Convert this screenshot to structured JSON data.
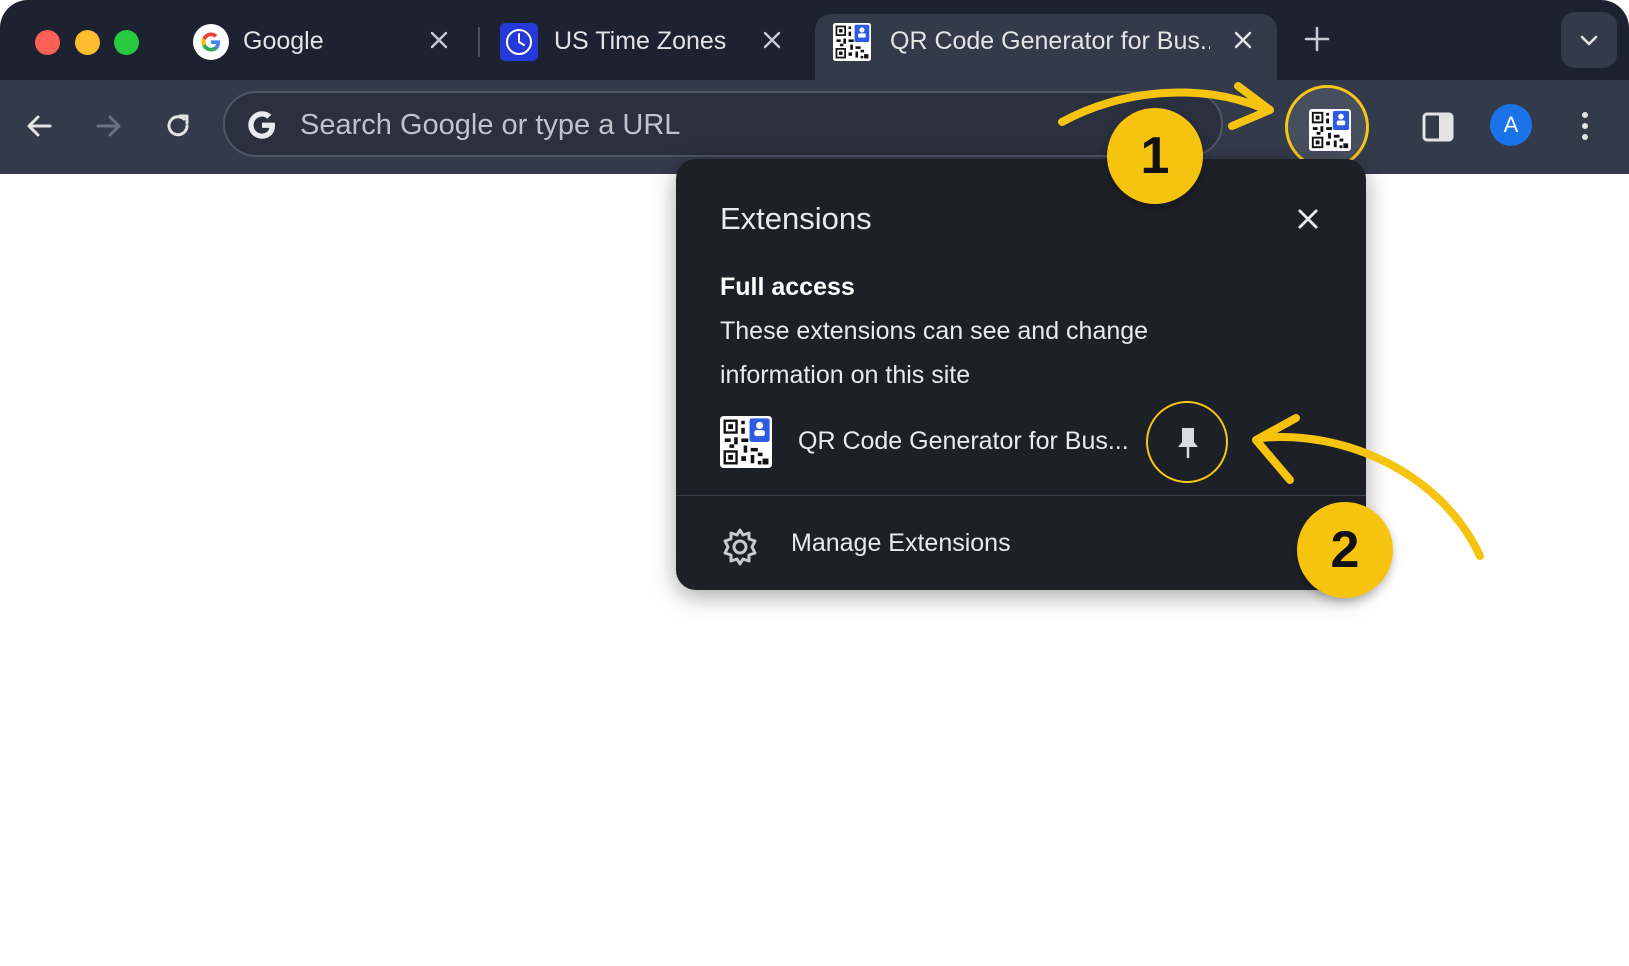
{
  "window": {
    "controls": [
      "close",
      "minimize",
      "zoom"
    ]
  },
  "tabs": [
    {
      "label": "Google",
      "icon": "google-g-icon",
      "active": false
    },
    {
      "label": "US Time Zones",
      "icon": "clock-icon",
      "active": false
    },
    {
      "label": "QR Code Generator for Bus..",
      "icon": "qr-code-icon",
      "active": true
    }
  ],
  "toolbar": {
    "omnibox_placeholder": "Search Google or type a URL",
    "profile_initial": "A"
  },
  "extensions_popup": {
    "title": "Extensions",
    "section_title": "Full access",
    "section_description": "These extensions can see and change information on this site",
    "extensions": [
      {
        "name": "QR Code Generator for Bus...",
        "icon": "qr-code-icon",
        "pinned": false
      }
    ],
    "manage_label": "Manage Extensions"
  },
  "annotations": {
    "step1": "1",
    "step2": "2",
    "accent_color": "#f6c40f"
  },
  "colors": {
    "tabstrip": "#1d2230",
    "toolbar": "#333a4a",
    "popup": "#1e2027",
    "avatar": "#1a73e8"
  }
}
